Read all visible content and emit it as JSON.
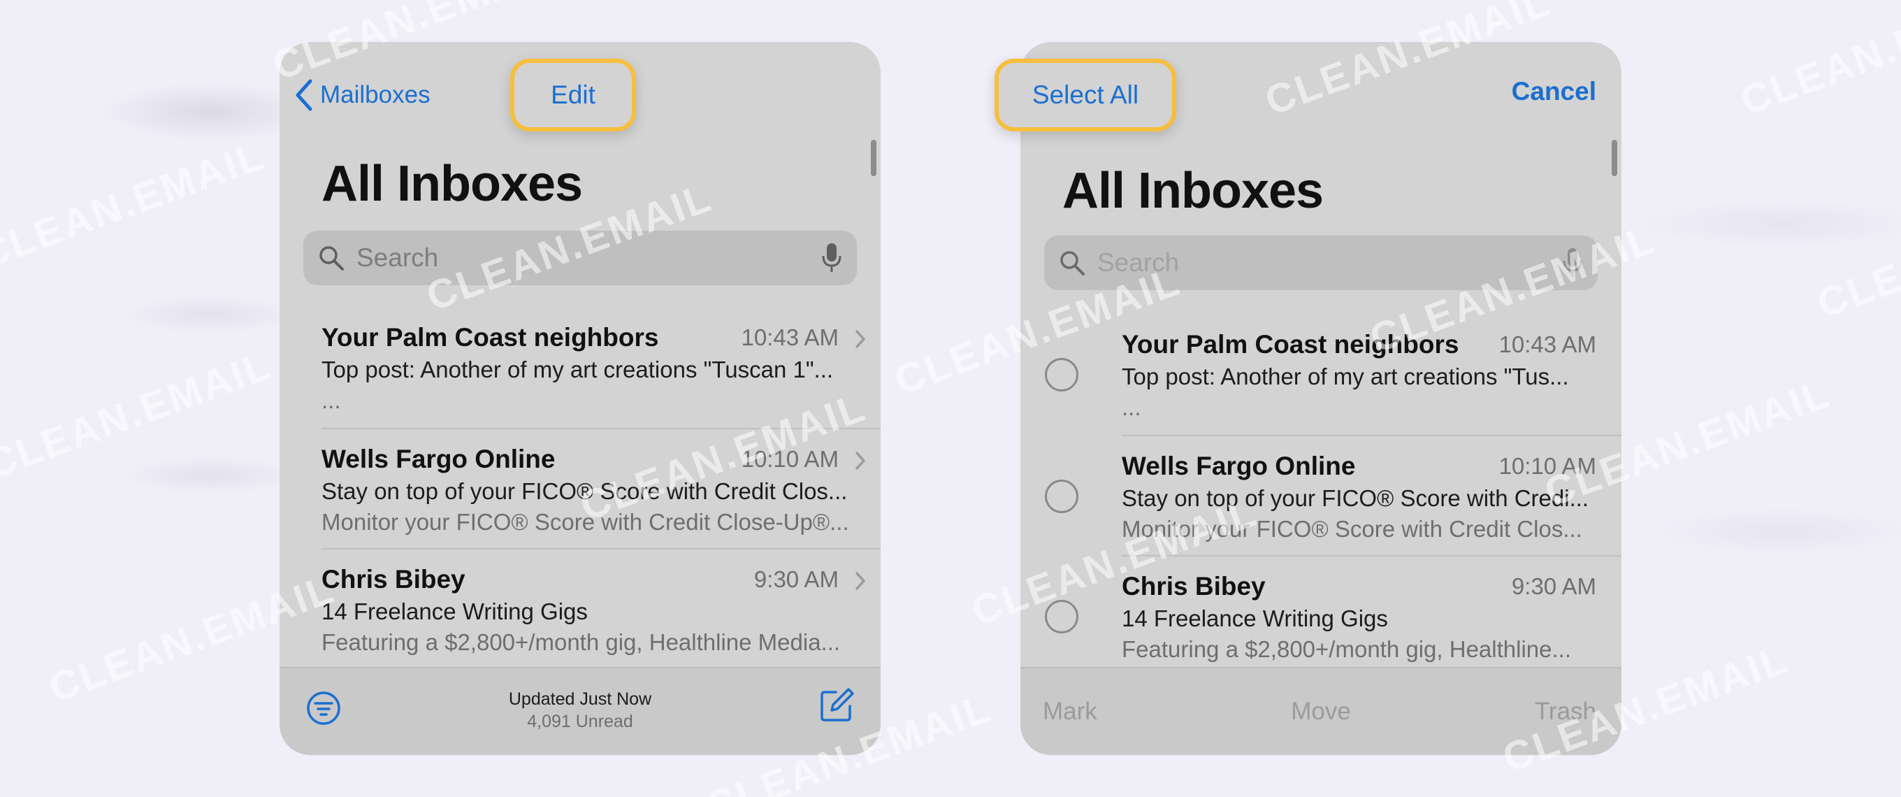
{
  "brand": {
    "watermark": "CLEAN.EMAIL",
    "accent_color": "#1a6fd0",
    "highlight_color": "#f6bf3c"
  },
  "left_panel": {
    "nav": {
      "back_label": "Mailboxes",
      "edit_label": "Edit"
    },
    "title": "All Inboxes",
    "search": {
      "placeholder": "Search"
    },
    "messages": [
      {
        "sender": "Your Palm Coast neighbors",
        "time": "10:43 AM",
        "subject": "Top post: Another of my art creations \"Tuscan 1\"...",
        "preview": "..."
      },
      {
        "sender": "Wells Fargo Online",
        "time": "10:10 AM",
        "subject": "Stay on top of your FICO® Score with Credit Clos...",
        "preview": "Monitor your FICO® Score with Credit Close-Up®..."
      },
      {
        "sender": "Chris Bibey",
        "time": "9:30 AM",
        "subject": "14 Freelance Writing Gigs",
        "preview": "Featuring a $2,800+/month gig, Healthline Media..."
      }
    ],
    "footer": {
      "updated": "Updated Just Now",
      "unread": "4,091 Unread"
    }
  },
  "right_panel": {
    "nav": {
      "select_all_label": "Select All",
      "cancel_label": "Cancel"
    },
    "title": "All Inboxes",
    "search": {
      "placeholder": "Search"
    },
    "messages": [
      {
        "sender": "Your Palm Coast neighbors",
        "time": "10:43 AM",
        "subject": "Top post: Another of my art creations \"Tus...",
        "preview": "..."
      },
      {
        "sender": "Wells Fargo Online",
        "time": "10:10 AM",
        "subject": "Stay on top of your FICO® Score with Credi...",
        "preview": "Monitor your FICO® Score with Credit Clos..."
      },
      {
        "sender": "Chris Bibey",
        "time": "9:30 AM",
        "subject": "14 Freelance Writing Gigs",
        "preview": "Featuring a $2,800+/month gig, Healthline..."
      }
    ],
    "actions": {
      "mark": "Mark",
      "move": "Move",
      "trash": "Trash"
    }
  }
}
